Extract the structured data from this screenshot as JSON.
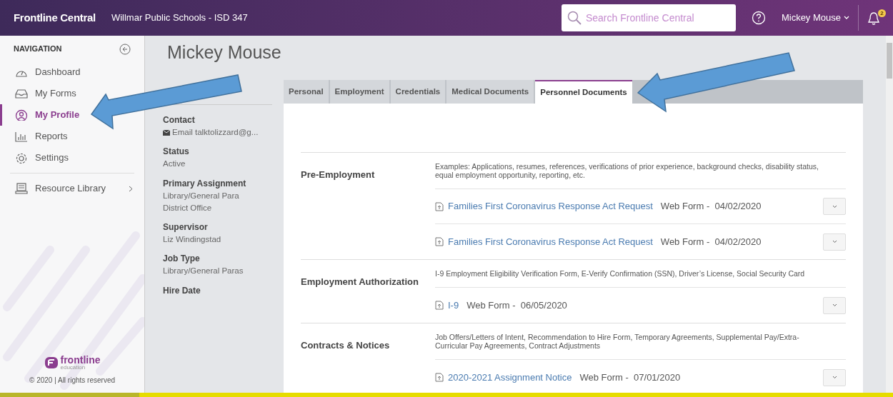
{
  "top_bar": {
    "app_name": "Frontline Central",
    "organization": "Willmar Public Schools - ISD 347",
    "search": {
      "placeholder": "Search Frontline Central"
    },
    "user_name": "Mickey Mouse",
    "notification_count": "2"
  },
  "sidebar": {
    "heading": "NAVIGATION",
    "items": [
      {
        "label": "Dashboard",
        "selected": false
      },
      {
        "label": "My Forms",
        "selected": false
      },
      {
        "label": "My Profile",
        "selected": true
      },
      {
        "label": "Reports",
        "selected": false
      },
      {
        "label": "Settings",
        "selected": false
      },
      {
        "label": "Resource Library",
        "selected": false,
        "kind": "submenu"
      }
    ],
    "footer": {
      "logo_text": "frontline",
      "logo_subtext": "education",
      "copyright": "© 2020 | All rights reserved"
    }
  },
  "profile": {
    "name": "Mickey Mouse",
    "fields": [
      {
        "label": "Contact",
        "kind": "email",
        "lines": [
          "Email talktolizzard@g..."
        ]
      },
      {
        "label": "Status",
        "kind": "text",
        "lines": [
          "Active"
        ]
      },
      {
        "label": "Primary Assignment",
        "kind": "text",
        "lines": [
          "Library/General Para",
          "District Office"
        ]
      },
      {
        "label": "Supervisor",
        "kind": "text",
        "lines": [
          "Liz Windingstad"
        ]
      },
      {
        "label": "Job Type",
        "kind": "text",
        "lines": [
          "Library/General Paras"
        ]
      },
      {
        "label": "Hire Date"
      }
    ]
  },
  "tabs": [
    {
      "label": "Personal",
      "selected": false
    },
    {
      "label": "Employment",
      "selected": false
    },
    {
      "label": "Credentials",
      "selected": false
    },
    {
      "label": "Medical Documents",
      "selected": false
    },
    {
      "label": "Personnel Documents",
      "selected": true
    }
  ],
  "sections": [
    {
      "title": "Pre-Employment",
      "description": "Examples: Applications, resumes, references, verifications of prior experience, background checks, disability status, equal employment opportunity, reporting, etc.",
      "documents": [
        {
          "name": "Families First Coronavirus Response Act Request",
          "meta": "Web Form -  04/02/2020"
        },
        {
          "name": "Families First Coronavirus Response Act Request",
          "meta": "Web Form -  04/02/2020"
        }
      ]
    },
    {
      "title": "Employment Authorization",
      "description": "I-9 Employment Eligibility Verification Form, E-Verify Confirmation (SSN), Driver’s License, Social Security Card",
      "documents": [
        {
          "name": "I-9",
          "meta": "Web Form -  06/05/2020"
        }
      ]
    },
    {
      "title": "Contracts & Notices",
      "description": "Job Offers/Letters of Intent, Recommendation to Hire Form, Temporary Agreements, Supplemental Pay/Extra-Curricular Pay Agreements, Contract Adjustments",
      "documents": [
        {
          "name": "2020-2021 Assignment Notice",
          "meta": "Web Form -  07/01/2020"
        }
      ]
    }
  ]
}
